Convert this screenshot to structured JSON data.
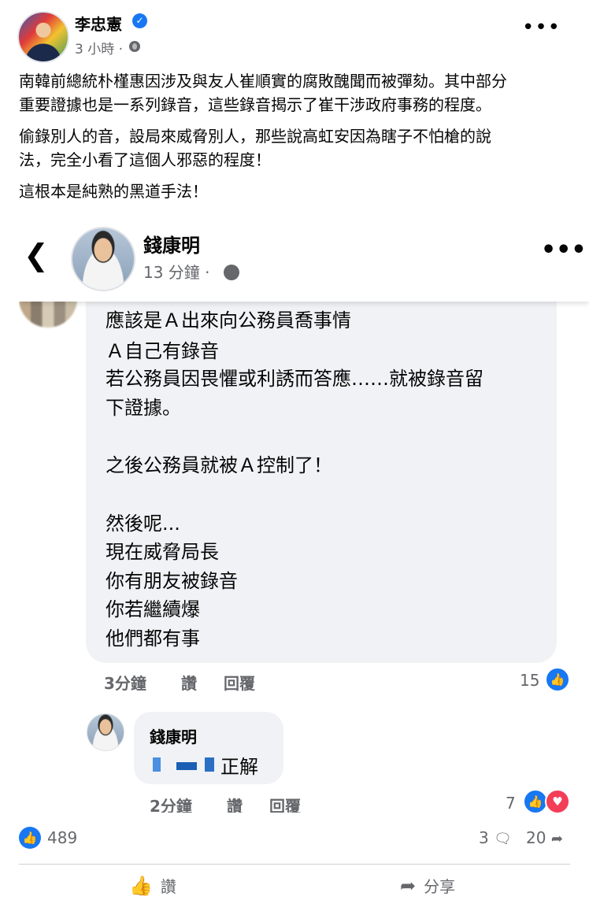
{
  "post": {
    "author": "李忠憲",
    "time": "3 小時 ·",
    "paragraphs": [
      "南韓前總統朴槿惠因涉及與友人崔順實的腐敗醜聞而被彈劾。其中部分",
      "重要證據也是一系列錄音，這些錄音揭示了崔干涉政府事務的程度。",
      "偷錄別人的音，設局來威脅別人，那些說高虹安因為瞎子不怕槍的說",
      "法，完全小看了這個人邪惡的程度！",
      "這根本是純熟的黑道手法！"
    ]
  },
  "embedded": {
    "author": "錢康明",
    "time": "13 分鐘 ·",
    "comment_lines": [
      "應該是Ａ出來向公務員喬事情",
      "Ａ自己有錄音",
      "若公務員因畏懼或利誘而答應……就被錄音留",
      "下證據。",
      "之後公務員就被Ａ控制了！",
      "然後呢...",
      "現在威脅局長",
      "你有朋友被錄音",
      "你若繼續爆",
      "他們都有事"
    ],
    "comment_meta": {
      "time": "3分鐘",
      "like": "讚",
      "reply": "回覆",
      "reactions": "15"
    },
    "reply": {
      "author": "錢康明",
      "text": "正解",
      "time": "2分鐘",
      "like": "讚",
      "reply_label": "回覆",
      "reactions": "7"
    }
  },
  "footer": {
    "likes": "489",
    "comments": "3",
    "shares": "20",
    "like_label": "讚",
    "share_label": "分享"
  },
  "icons": {
    "verified": "✓",
    "back": "‹",
    "like": "👍",
    "comment": "💬",
    "share": "↗"
  },
  "colors": {
    "facebook_blue": "#1877f2",
    "love_red": "#f33e58",
    "muted": "#65676b"
  }
}
